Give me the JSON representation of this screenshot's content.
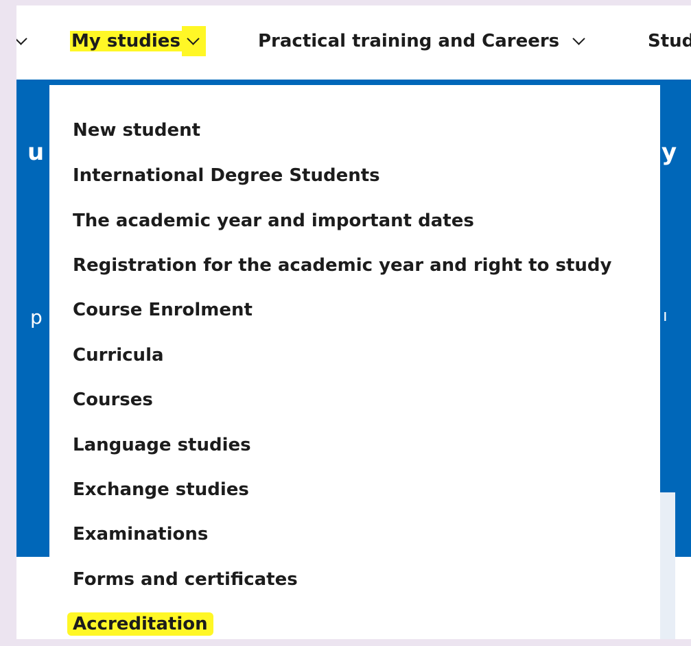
{
  "topnav": {
    "items": [
      {
        "label": ""
      },
      {
        "label": "My studies"
      },
      {
        "label": "Practical training and Careers"
      },
      {
        "label": "Stud"
      }
    ]
  },
  "hero": {
    "left_heading_fragment": "u",
    "left_sub_fragment": "p",
    "right_heading_fragment": "y",
    "right_sub_fragment": "ı"
  },
  "dropdown": {
    "items": [
      {
        "label": "New student"
      },
      {
        "label": "International Degree Students"
      },
      {
        "label": "The academic year and important dates"
      },
      {
        "label": "Registration for the academic year and right to study"
      },
      {
        "label": "Course Enrolment"
      },
      {
        "label": "Curricula"
      },
      {
        "label": "Courses"
      },
      {
        "label": "Language studies"
      },
      {
        "label": "Exchange studies"
      },
      {
        "label": "Examinations"
      },
      {
        "label": "Forms and certificates"
      },
      {
        "label": "Accreditation"
      }
    ]
  },
  "colors": {
    "highlight": "#fff726",
    "brand_blue": "#0067b9",
    "background": "#ece4f0"
  },
  "icons": {
    "nav_chevron": "chevron-down-icon"
  }
}
